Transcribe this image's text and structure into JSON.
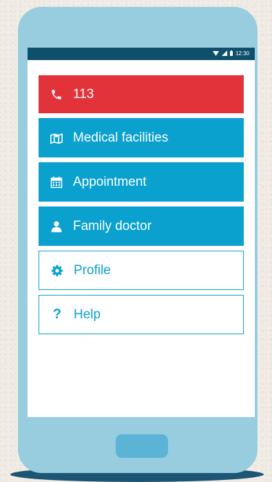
{
  "status_bar": {
    "time": "12:30",
    "icons": [
      "wifi-icon",
      "signal-icon",
      "battery-icon"
    ]
  },
  "menu": {
    "items": [
      {
        "label": "113",
        "icon": "phone-icon",
        "style": "red"
      },
      {
        "label": "Medical facilities",
        "icon": "map-icon",
        "style": "blue"
      },
      {
        "label": "Appointment",
        "icon": "calendar-icon",
        "style": "blue"
      },
      {
        "label": "Family doctor",
        "icon": "person-icon",
        "style": "blue"
      },
      {
        "label": "Profile",
        "icon": "gear-icon",
        "style": "outline"
      },
      {
        "label": "Help",
        "icon": "question-icon",
        "style": "outline"
      }
    ]
  },
  "colors": {
    "emergency": "#e2323a",
    "primary": "#0aa1cf",
    "status_bar": "#0e4f6c",
    "phone_body": "#98cde0"
  }
}
